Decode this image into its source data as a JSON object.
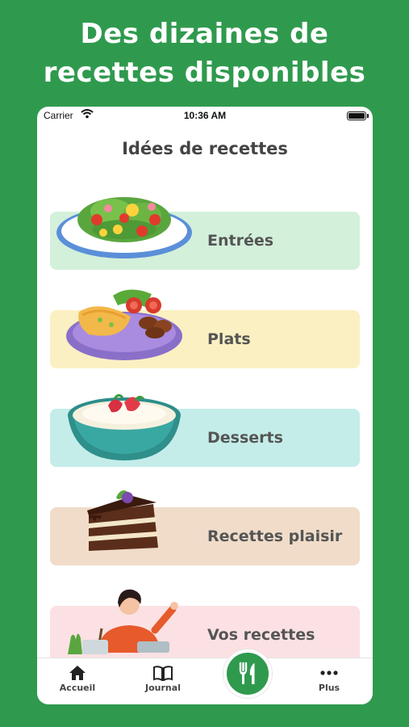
{
  "promo": {
    "headline_line1": "Des dizaines de",
    "headline_line2": "recettes disponibles"
  },
  "statusbar": {
    "carrier": "Carrier",
    "time": "10:36 AM"
  },
  "screen": {
    "title": "Idées de recettes"
  },
  "categories": [
    {
      "label": "Entrées",
      "color": "#d3f0db",
      "image": "salad-plate-image"
    },
    {
      "label": "Plats",
      "color": "#fbf0c2",
      "image": "omelette-plate-image"
    },
    {
      "label": "Desserts",
      "color": "#c4ede9",
      "image": "strawberry-dessert-bowl-image"
    },
    {
      "label": "Recettes plaisir",
      "color": "#f0dcc9",
      "image": "chocolate-cake-slice-image"
    },
    {
      "label": "Vos recettes",
      "color": "#fbe1e3",
      "image": "person-cooking-image"
    }
  ],
  "tabbar": {
    "items": [
      {
        "label": "Accueil",
        "icon": "home-icon"
      },
      {
        "label": "Journal",
        "icon": "book-icon"
      },
      {
        "label": "",
        "icon": "fork-knife-icon"
      },
      {
        "label": "Plus",
        "icon": "more-dots-icon"
      }
    ]
  },
  "colors": {
    "brand_green": "#2f9a4e"
  }
}
